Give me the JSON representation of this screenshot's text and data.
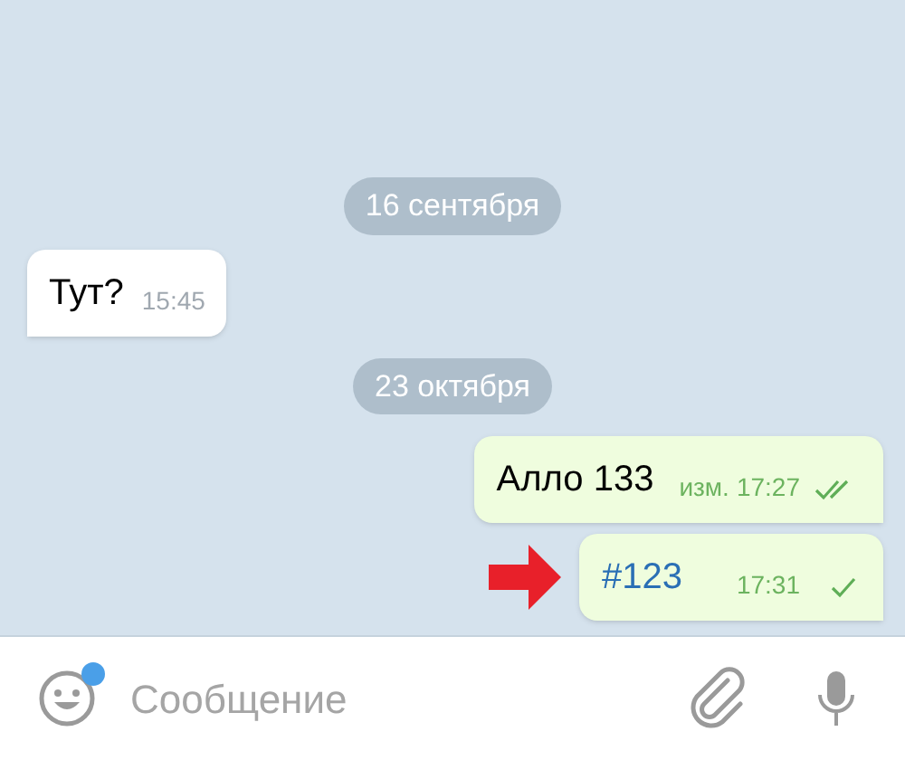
{
  "messages": [
    {
      "kind": "date",
      "text": "16 сентября"
    },
    {
      "kind": "incoming",
      "text": "Тут?",
      "time": "15:45"
    },
    {
      "kind": "date",
      "text": "23 октября"
    },
    {
      "kind": "outgoing",
      "text": "Алло 133",
      "edited": "изм.",
      "time": "17:27",
      "read": true,
      "hashtag": false,
      "pointed": false
    },
    {
      "kind": "outgoing",
      "text": "#123",
      "time": "17:31",
      "read": false,
      "hashtag": true,
      "pointed": true
    }
  ],
  "composer": {
    "placeholder": "Сообщение",
    "emoji_badge": true
  }
}
